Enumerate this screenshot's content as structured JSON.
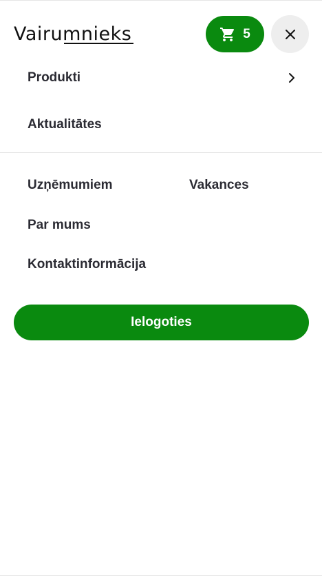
{
  "brand": {
    "logo_text": "Vairumnieks"
  },
  "header": {
    "cart_count": "5",
    "cart_icon": "shopping-cart-icon",
    "close_icon": "close-icon"
  },
  "primary_nav": {
    "items": [
      {
        "label": "Produkti",
        "has_submenu": true
      },
      {
        "label": "Aktualitātes",
        "has_submenu": false
      }
    ]
  },
  "secondary_nav": {
    "items": [
      {
        "label": "Uzņēmumiem"
      },
      {
        "label": "Vakances"
      },
      {
        "label": "Par mums"
      },
      {
        "label": "Kontaktinformācija"
      }
    ]
  },
  "login": {
    "label": "Ielogoties"
  },
  "colors": {
    "accent": "#0a8a0f",
    "text": "#2b2b33",
    "close_bg": "#eeeeee",
    "divider": "#e5e5e5"
  }
}
